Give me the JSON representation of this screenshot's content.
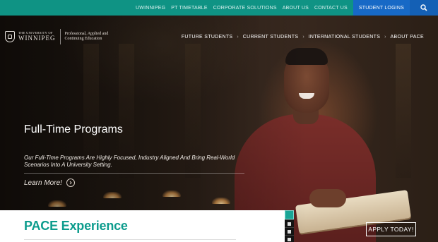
{
  "colors": {
    "topbar": "#0f9384",
    "student_logins": "#1769c6",
    "accent_teal": "#0d9c8d"
  },
  "utility_nav": {
    "links": [
      "UWINNIPEG",
      "PT TIMETABLE",
      "CORPORATE SOLUTIONS",
      "ABOUT US",
      "CONTACT US"
    ],
    "student_logins": "STUDENT LOGINS",
    "search_icon": "search-icon"
  },
  "logo": {
    "university_top": "THE UNIVERSITY OF",
    "university_name": "WINNIPEG",
    "pace_line1": "Professional, Applied and",
    "pace_line2": "Continuing Education"
  },
  "main_nav": {
    "items": [
      "FUTURE STUDENTS",
      "CURRENT STUDENTS",
      "INTERNATIONAL STUDENTS",
      "ABOUT PACE"
    ]
  },
  "hero": {
    "title": "Full-Time Programs",
    "description": "Our Full-Time Programs Are Highly Focused, Industry Aligned And Bring Real-World Scenarios Into A University Setting.",
    "learn_more": "Learn More!",
    "learn_more_icon": "chevron-right-circle-icon"
  },
  "pace_section": {
    "title": "PACE Experience"
  },
  "apply_button": "APPLY TODAY!"
}
